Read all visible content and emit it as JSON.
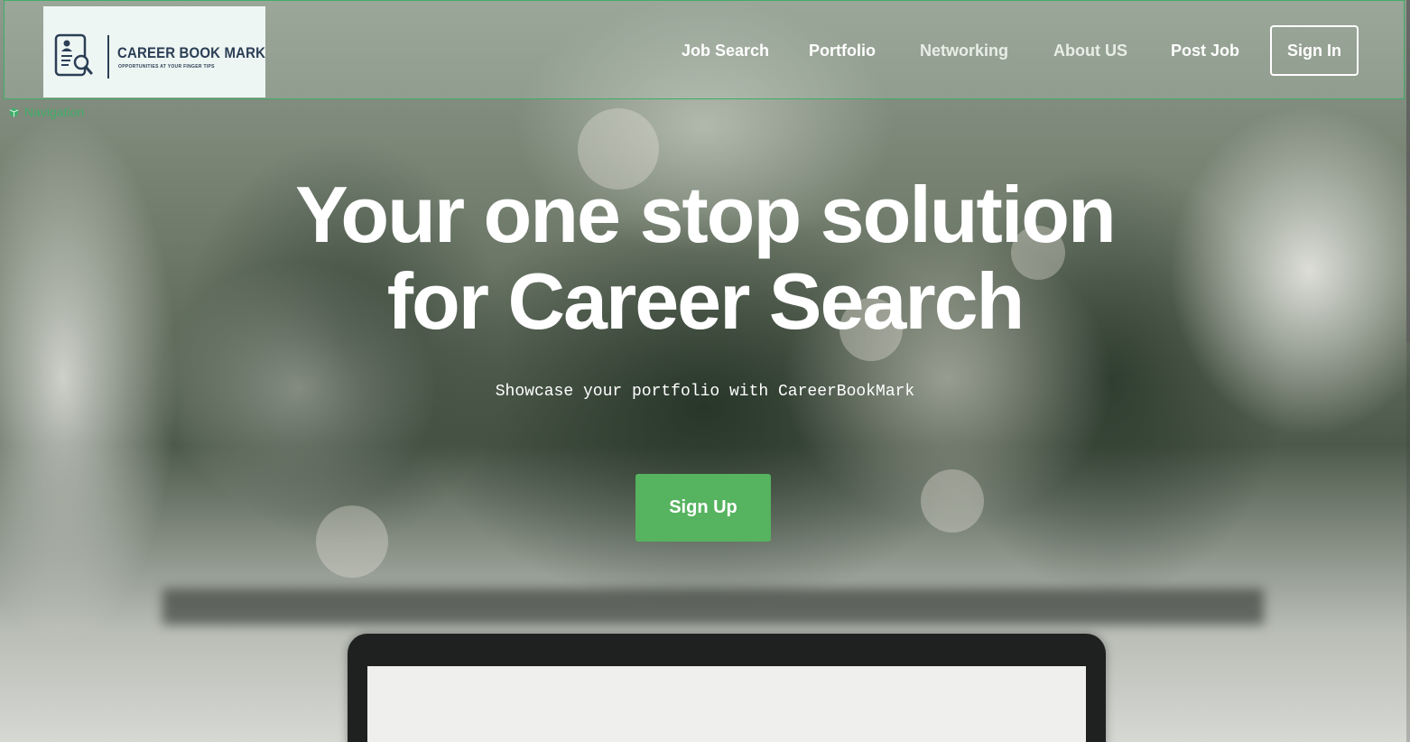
{
  "logo": {
    "title": "CAREER BOOK MARK",
    "tagline": "OPPORTUNITIES AT YOUR FINGER TIPS",
    "icon": "resume-search-icon"
  },
  "nav": {
    "tag_label": "Navigation",
    "tag_icon": "cube-icon",
    "links": [
      {
        "label": "Job Search"
      },
      {
        "label": "Portfolio"
      },
      {
        "label": "Networking"
      },
      {
        "label": "About US"
      },
      {
        "label": "Post Job"
      }
    ],
    "sign_in": "Sign In"
  },
  "hero": {
    "title_line1": "Your one stop solution",
    "title_line2": "for Career Search",
    "subtitle": "Showcase your portfolio with CareerBookMark",
    "cta": "Sign Up"
  },
  "colors": {
    "accent_green": "#56b35f",
    "nav_outline": "#3fae6a",
    "logo_navy": "#2b3e55"
  }
}
